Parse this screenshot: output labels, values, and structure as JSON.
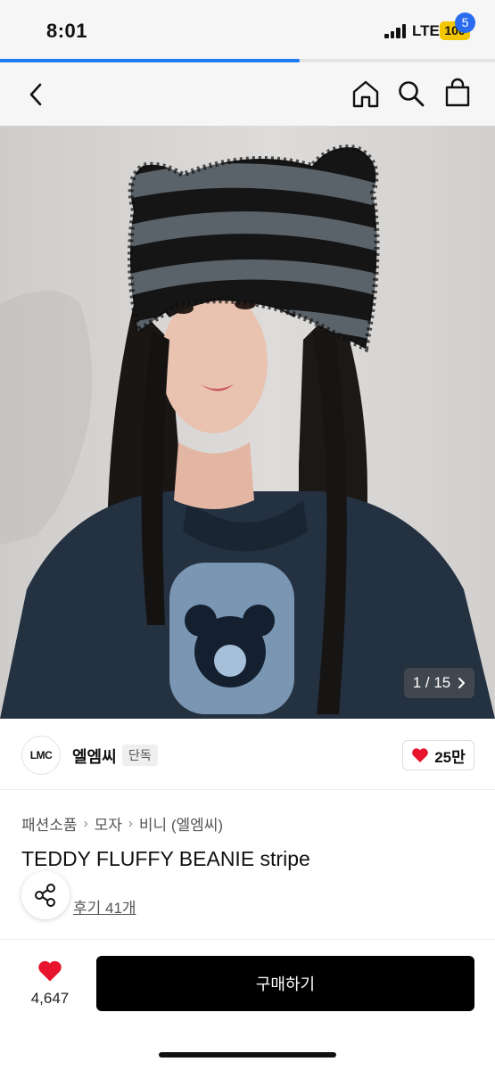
{
  "status_bar": {
    "time": "8:01",
    "network": "LTE",
    "battery": "100"
  },
  "page_load_progress": 0.605,
  "header": {
    "back_icon": "chevron-left-icon",
    "home_icon": "home-icon",
    "search_icon": "search-icon",
    "cart_icon": "shopping-bag-icon",
    "cart_count": "5"
  },
  "gallery": {
    "counter": "1 / 15",
    "next_icon": "chevron-right-icon"
  },
  "brand": {
    "logo_text": "LMC",
    "name": "엘엠씨",
    "tag": "단독",
    "likes": "25만"
  },
  "product": {
    "breadcrumb": [
      "패션소품",
      "모자",
      "비니 (엘엠씨)"
    ],
    "title": "TEDDY FLUFFY BEANIE stripe",
    "reviews": "후기 41개"
  },
  "bottom_bar": {
    "wish_count": "4,647",
    "buy_label": "구매하기"
  },
  "colors": {
    "accent_blue": "#1d7cf2",
    "badge_blue": "#2a6cf0",
    "heart_red": "#e8132c",
    "buy_button": "#000000"
  }
}
